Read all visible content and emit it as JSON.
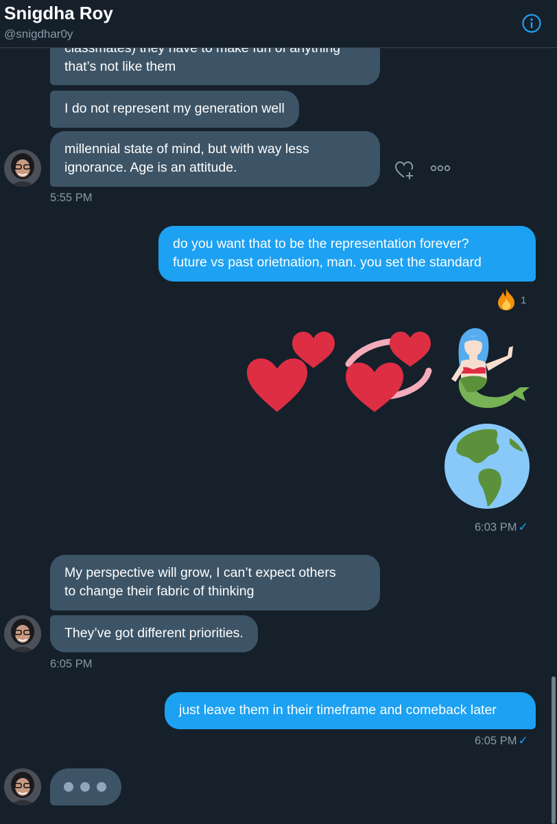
{
  "header": {
    "name": "Snigdha Roy",
    "handle": "@snigdhar0y",
    "info_icon": "info-icon"
  },
  "messages": {
    "m1_line1": "classmates) they have to make fun of anything",
    "m1_line2": "that’s not like them",
    "m2": "I do not represent my generation well",
    "m3_line1": "millennial state of mind, but with way less",
    "m3_line2": "ignorance. Age is an attitude.",
    "t1": "5:55 PM",
    "m4_line1": "do you want that to be the representation forever?",
    "m4_line2": "future vs past orietnation, man. you set the standard",
    "reaction_count": "1",
    "t2": "6:03 PM",
    "m5_line1": "My perspective will grow, I can’t expect others",
    "m5_line2": "to change their fabric of thinking",
    "m6": "They’ve got different priorities.",
    "t3": "6:05 PM",
    "m7": "just leave them in their timeframe and comeback later",
    "t4": "6:05 PM"
  },
  "emojis": [
    "two-hearts-emoji",
    "revolving-hearts-emoji",
    "mermaid-emoji",
    "globe-americas-emoji",
    "fire-emoji"
  ],
  "colors": {
    "background": "#15202b",
    "incoming_bubble": "#3d5466",
    "outgoing_bubble": "#1da1f2",
    "muted_text": "#8899a6"
  }
}
